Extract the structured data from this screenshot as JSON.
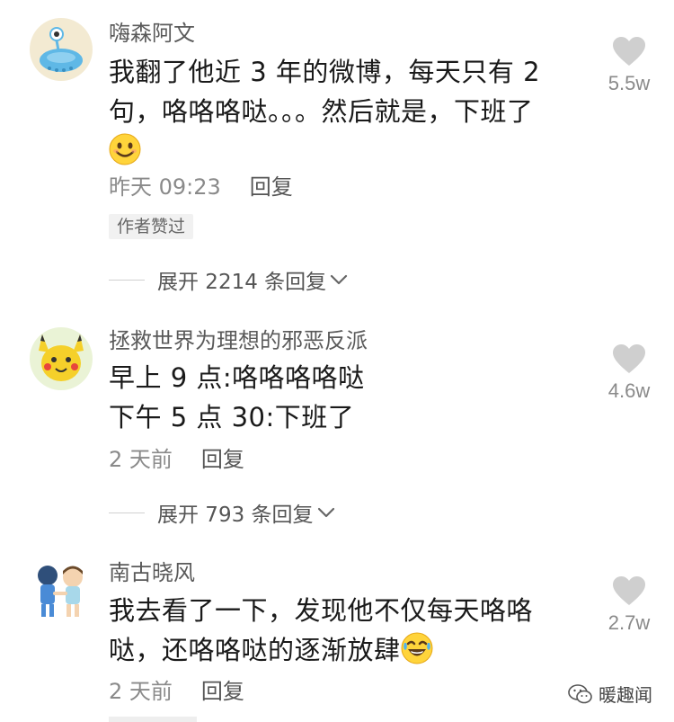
{
  "comments": [
    {
      "username": "嗨森阿文",
      "lines": [
        "我翻了他近 3 年的微博，每天只有 2",
        "句，咯咯咯哒。。。然后就是，下班了"
      ],
      "time": "昨天 09:23",
      "reply_label": "回复",
      "author_badge": "作者赞过",
      "likes": "5.5w",
      "expand_label": "展开 2214 条回复"
    },
    {
      "username": "拯救世界为理想的邪恶反派",
      "lines": [
        "早上 9 点:咯咯咯咯哒",
        "下午 5 点 30:下班了"
      ],
      "time": "2 天前",
      "reply_label": "回复",
      "likes": "4.6w",
      "expand_label": "展开 793 条回复"
    },
    {
      "username": "南古晓风",
      "lines": [
        "我去看了一下，发现他不仅每天咯咯",
        "哒，还咯咯哒的逐渐放肆"
      ],
      "time": "2 天前",
      "reply_label": "回复",
      "likes": "2.7w"
    }
  ],
  "watermark": "暖趣闻",
  "icons": {
    "like": "heart-icon",
    "expand": "chevron-down-icon",
    "emoji_1": "smile-emoji-icon",
    "emoji_3": "sweat-laugh-emoji-icon",
    "watermark": "wechat-logo-icon"
  },
  "colors": {
    "heart": "#cfcfcf",
    "meta_text": "#8a8a8a",
    "badge_bg": "#f1f1f1"
  }
}
